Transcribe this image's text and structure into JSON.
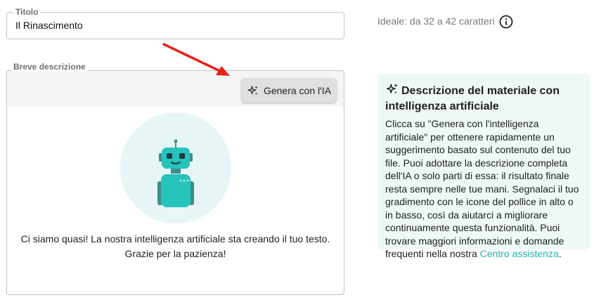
{
  "title_field": {
    "label": "Titolo",
    "value": "Il Rinascimento",
    "hint": "Ideale: da 32 a 42 caratteri",
    "hint_icon": "info-icon"
  },
  "description_field": {
    "label": "Breve descrizione",
    "generate_button": {
      "label": "Genera con l'IA",
      "icon": "sparkles-icon"
    },
    "robot_icon": "robot-icon",
    "status_text": "Ci siamo quasi! La nostra intelligenza artificiale sta creando il tuo testo. Grazie per la pazienza!"
  },
  "ai_card": {
    "icon": "sparkles-icon",
    "heading": "Descrizione del materiale con intelligenza artificiale",
    "body": "Clicca su \"Genera con l'intelligenza artificiale\" per ottenere rapidamente un suggerimento basato sul contenuto del tuo file. Puoi adottare la descrizione completa dell'IA o solo parti di essa: il risultato finale resta sempre nelle tue mani. Segnalaci il tuo gradimento con le icone del pollice in alto o in basso, così da aiutarci a migliorare continuamente questa funzionalità. Puoi trovare maggiori informazioni e domande frequenti nella nostra ",
    "link_text": "Centro assistenza",
    "body_end": "."
  },
  "colors": {
    "accent_teal": "#1fb3ad",
    "card_bg": "#eef8f7",
    "arrow_red": "#e8221b"
  }
}
